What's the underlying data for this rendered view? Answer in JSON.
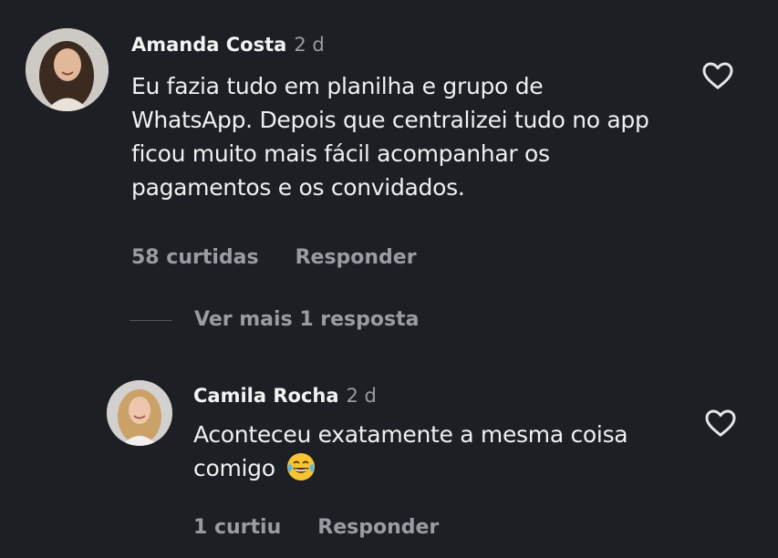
{
  "comments": [
    {
      "author": "Amanda Costa",
      "time": "2 d",
      "text": "Eu fazia tudo em planilha e grupo de WhatsApp. Depois que centralizei tudo no app ficou muito mais fácil acompanhar os pagamentos e os convidados.",
      "likes_label": "58 curtidas",
      "reply_label": "Responder",
      "avatar_icon": "woman-avatar",
      "like_icon": "heart-outline-icon"
    },
    {
      "author": "Camila Rocha",
      "time": "2 d",
      "text": "Aconteceu exatamente a mesma coisa comigo",
      "emoji": "face-with-tears-of-joy",
      "likes_label": "1 curtiu",
      "reply_label": "Responder",
      "avatar_icon": "woman-avatar",
      "like_icon": "heart-outline-icon"
    }
  ],
  "more_replies_label": "Ver mais 1 resposta",
  "colors": {
    "background": "#1d1f24",
    "primary_text": "#f0f0f0",
    "secondary_text": "#9a9ca3"
  }
}
